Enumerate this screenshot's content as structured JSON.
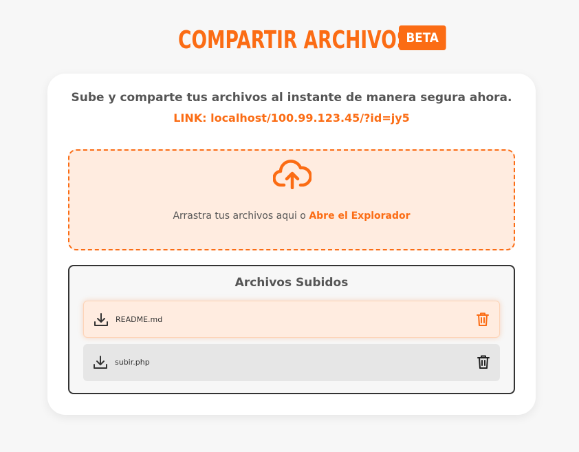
{
  "header": {
    "title": "COMPARTIR ARCHIVOS",
    "badge": "BETA"
  },
  "card": {
    "subtitle": "Sube y comparte tus archivos al instante de manera segura ahora.",
    "link": "LINK: localhost/100.99.123.45/?id=jy5"
  },
  "dropzone": {
    "icon": "cloud-upload-icon",
    "text": "Arrastra tus archivos aqui o ",
    "link_label": "Abre el Explorador"
  },
  "files": {
    "title": "Archivos Subidos",
    "items": [
      {
        "name": "README.md",
        "icon": "download-icon",
        "action_icon": "trash-icon"
      },
      {
        "name": "subir.php",
        "icon": "download-icon",
        "action_icon": "trash-icon"
      }
    ]
  },
  "colors": {
    "accent": "#fb6c14",
    "accent_light": "#ffece0",
    "text_gray": "#555555",
    "page_bg": "#f7f7f7"
  }
}
